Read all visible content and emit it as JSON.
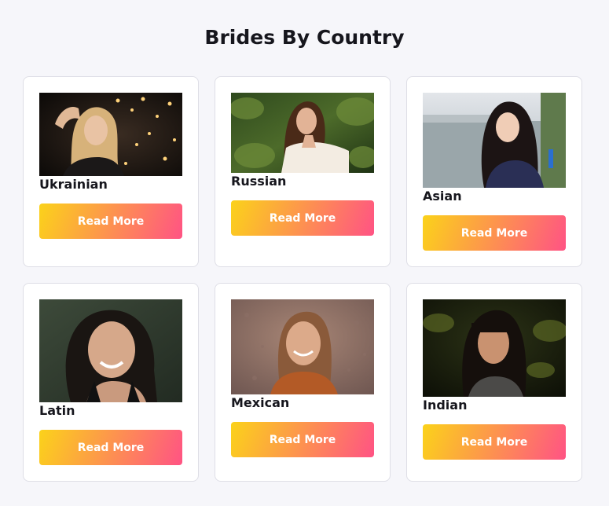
{
  "page": {
    "title": "Brides By Country"
  },
  "colors": {
    "gradient_start": "#fbd21a",
    "gradient_end": "#ff5384",
    "card_border": "#dedee6",
    "background": "#f6f6fa"
  },
  "cards": [
    {
      "name": "Ukrainian",
      "button_label": "Read More"
    },
    {
      "name": "Russian",
      "button_label": "Read More"
    },
    {
      "name": "Asian",
      "button_label": "Read More"
    },
    {
      "name": "Latin",
      "button_label": "Read More"
    },
    {
      "name": "Mexican",
      "button_label": "Read More"
    },
    {
      "name": "Indian",
      "button_label": "Read More"
    }
  ]
}
